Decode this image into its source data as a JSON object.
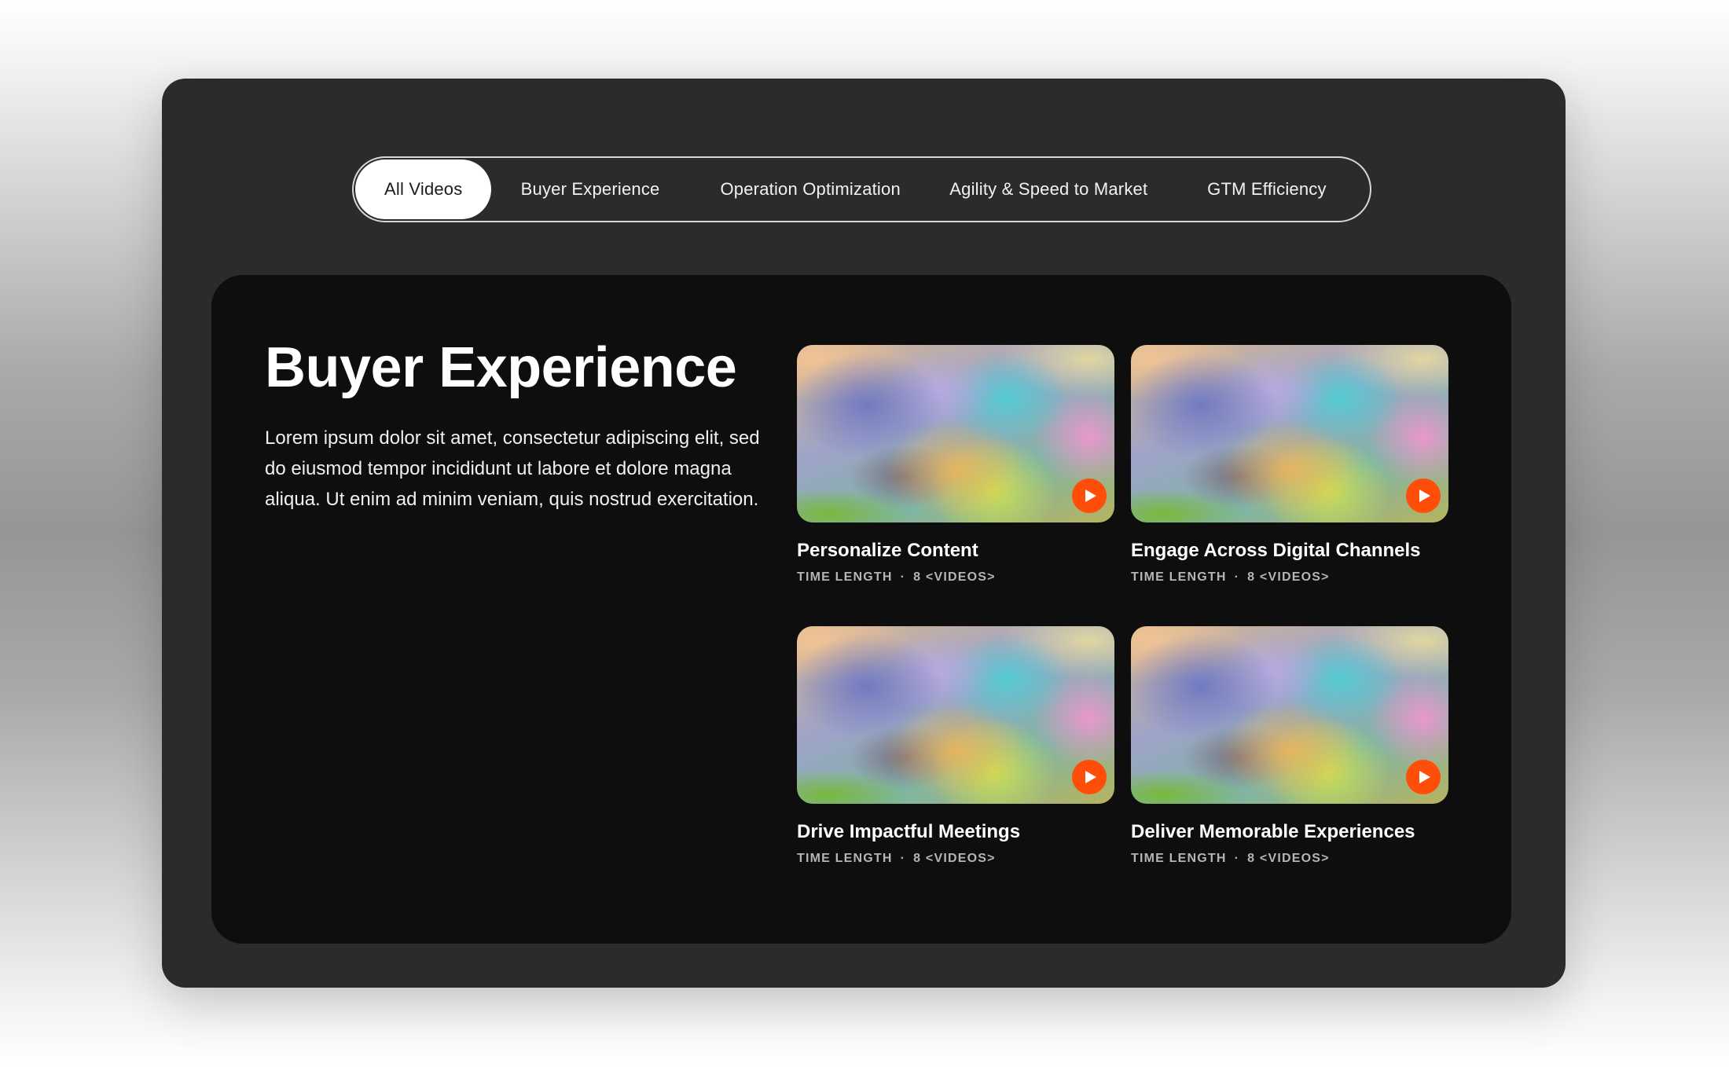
{
  "tabs": [
    {
      "label": "All Videos",
      "active": true
    },
    {
      "label": "Buyer Experience",
      "active": false
    },
    {
      "label": "Operation Optimization",
      "active": false
    },
    {
      "label": "Agility & Speed to Market",
      "active": false
    },
    {
      "label": "GTM Efficiency",
      "active": false
    }
  ],
  "section": {
    "title": "Buyer Experience",
    "description": "Lorem ipsum dolor sit amet, consectetur adipiscing elit, sed do eiusmod tempor incididunt ut labore et dolore magna aliqua. Ut enim ad minim veniam, quis nostrud exercitation."
  },
  "videos": [
    {
      "title": "Personalize Content",
      "time": "TIME LENGTH",
      "separator": "·",
      "count": "8 <VIDEOS>"
    },
    {
      "title": "Engage Across Digital Channels",
      "time": "TIME LENGTH",
      "separator": "·",
      "count": "8 <VIDEOS>"
    },
    {
      "title": "Drive Impactful Meetings",
      "time": "TIME LENGTH",
      "separator": "·",
      "count": "8 <VIDEOS>"
    },
    {
      "title": "Deliver Memorable Experiences",
      "time": "TIME LENGTH",
      "separator": "·",
      "count": "8 <VIDEOS>"
    }
  ],
  "icons": {
    "play": "play-icon"
  },
  "colors": {
    "play_button": "#ff4d0a",
    "frame_background": "#2b2b2b",
    "panel_background": "#0e0e0e",
    "active_tab_background": "#ffffff"
  }
}
